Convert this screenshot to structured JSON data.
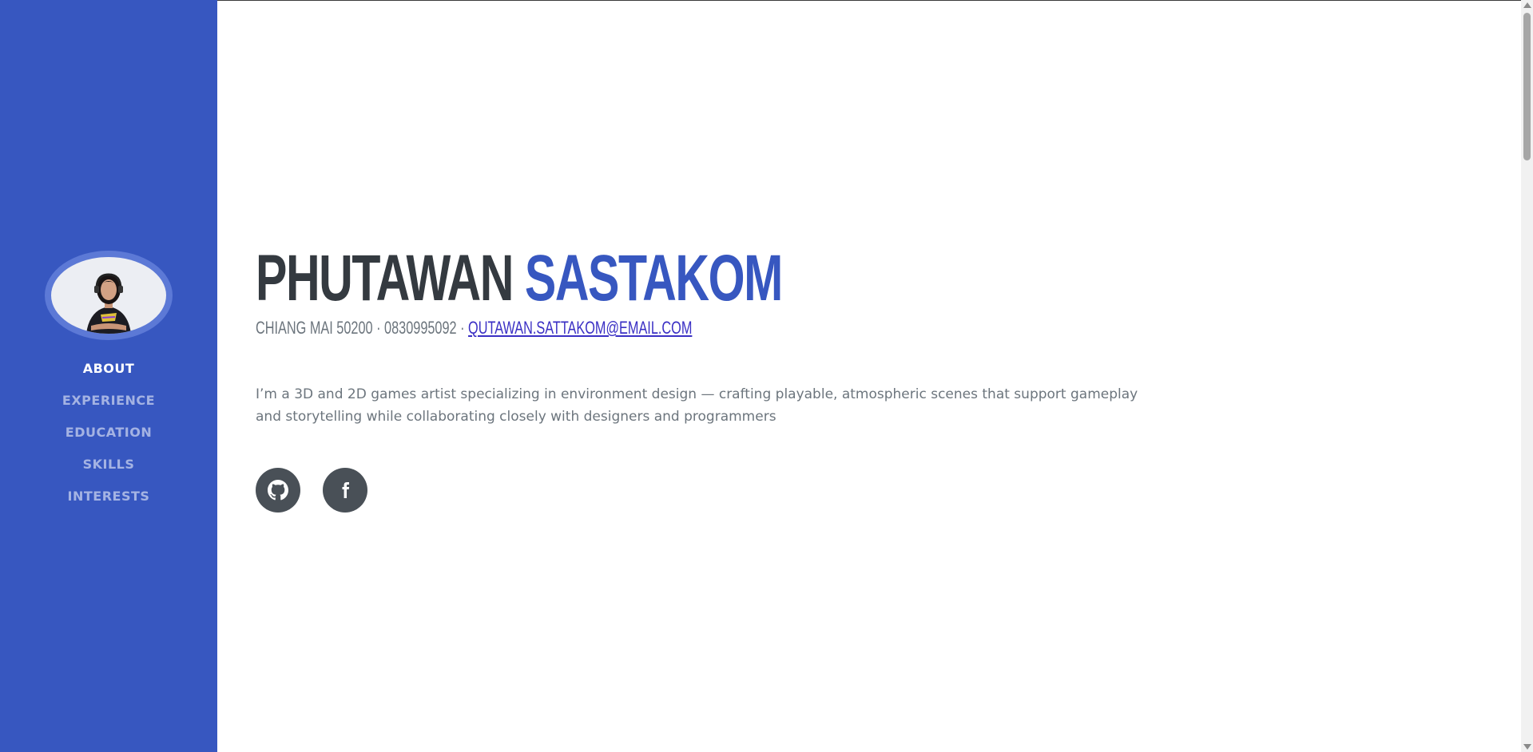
{
  "sidebar": {
    "avatar_alt": "profile photo",
    "nav": [
      {
        "label": "ABOUT",
        "active": true
      },
      {
        "label": "EXPERIENCE",
        "active": false
      },
      {
        "label": "EDUCATION",
        "active": false
      },
      {
        "label": "SKILLS",
        "active": false
      },
      {
        "label": "INTERESTS",
        "active": false
      }
    ]
  },
  "about": {
    "first_name": "PHUTAWAN",
    "last_name": "SASTAKOM",
    "address_phone": "CHIANG MAI 50200 · 0830995092 · ",
    "email": "QUTAWAN.SATTAKOM@EMAIL.COM",
    "description": "I’m a 3D and 2D games artist specializing in environment design — crafting playable, atmospheric scenes that support gameplay and storytelling while collaborating closely with designers and programmers"
  },
  "social": [
    {
      "icon": "github-icon"
    },
    {
      "icon": "facebook-icon"
    }
  ],
  "colors": {
    "primary": "#3757c0",
    "heading": "#343a40",
    "muted": "#6c757d",
    "social_bg": "#495057",
    "link": "#3a2fc4"
  }
}
